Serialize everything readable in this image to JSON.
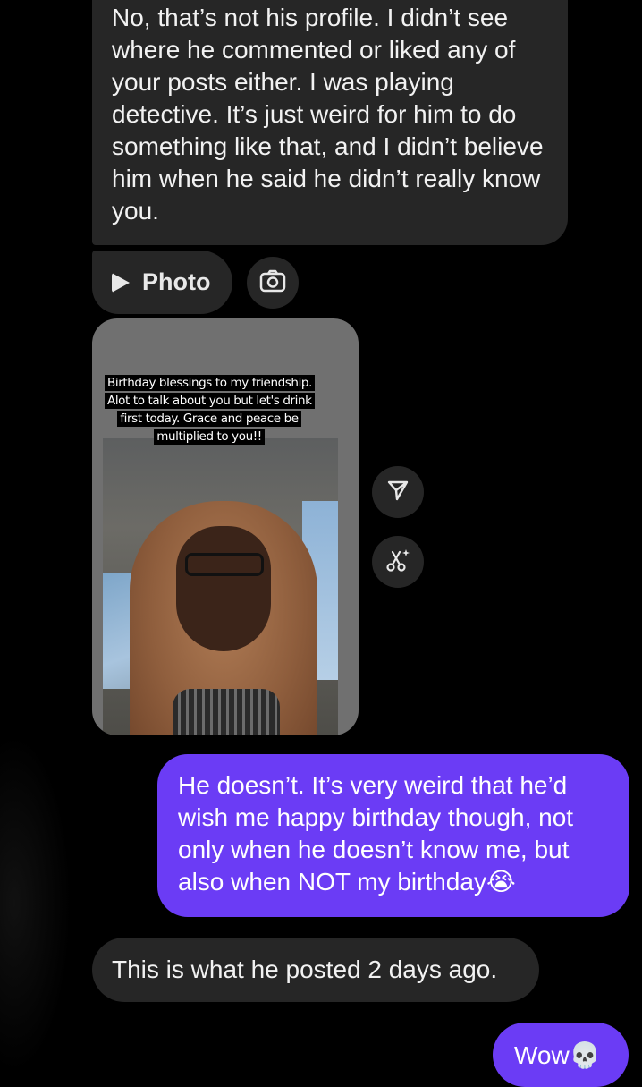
{
  "conversation": {
    "messages": [
      {
        "direction": "incoming",
        "text": "No, that’s not his profile. I didn’t see where he commented or liked any of your posts either. I was playing detective. It’s just weird for him to do something like that, and I didn’t believe him when he said he didn’t really know you."
      },
      {
        "direction": "incoming",
        "type": "photo-placeholder",
        "label": "Photo",
        "icons": [
          "play-icon",
          "camera-icon"
        ]
      },
      {
        "direction": "incoming",
        "type": "shared-story",
        "caption": "Birthday blessings to my friendship. Alot to talk about you but let's drink first today. Grace and peace be multiplied to you!!",
        "actions": [
          "share-icon",
          "remix-icon"
        ]
      },
      {
        "direction": "outgoing",
        "text": "He doesn’t. It’s very weird that he’d wish me happy birthday though, not only when he doesn’t know me, but also when NOT my birthday",
        "emoji": "😭"
      },
      {
        "direction": "incoming",
        "text": "This is what he posted 2 days ago."
      },
      {
        "direction": "outgoing",
        "text": "Wow",
        "emoji": "💀"
      }
    ]
  },
  "colors": {
    "background": "#000000",
    "incoming_bubble": "#262626",
    "outgoing_bubble": "#6b3cf5",
    "text": "#f2f2f2"
  }
}
